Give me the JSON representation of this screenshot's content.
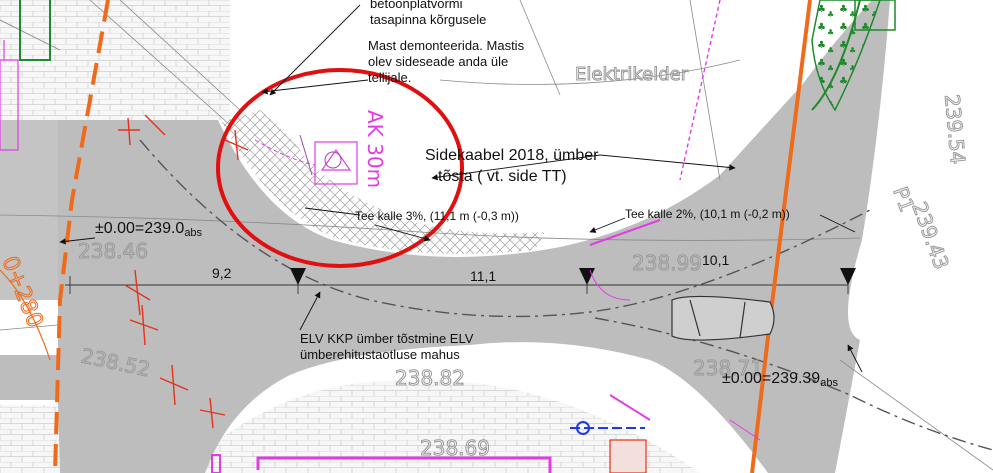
{
  "colors": {
    "road": "#bdbdbd",
    "paving_lines": "#d3d3d3",
    "redline": "#e8301c",
    "markup_circle": "#e01010",
    "magenta": "#e23be6",
    "orange": "#f06a1c",
    "green": "#1d8a2b",
    "blue": "#1f3ce0"
  },
  "annotations": {
    "top_note": "betoonplatvormi\ntasapinna kõrgusele",
    "mast_note": "Mast demonteerida. Mastis\nolev sideseade anda üle\ntellijale.",
    "cable_note": "Sidekaabel 2018,  ümber\ntõsta ( vt. side TT)",
    "slope_left": "Tee kalle 3%, (11,1 m (-0,3 m))",
    "slope_right": "Tee kalle 2%, (10,1 m (-0,2 m))",
    "elv_note": "ELV KKP ümber tõstmine ELV\nümberehitustaotluse mahus",
    "level_left": {
      "main": "±0.00=239.0",
      "sub": "abs"
    },
    "level_right": {
      "main": "±0.00=239.39",
      "sub": "abs"
    }
  },
  "dimensions": [
    "9,2",
    "11,1",
    "10,1"
  ],
  "labels": {
    "ak": "AK 30m",
    "elektrikelder": "Elektrikelder"
  },
  "ghost_elevations": [
    "239.54",
    "P1",
    "239.43",
    "238.46",
    "238.52",
    "238.82",
    "238.99",
    "238.71",
    "238.69"
  ],
  "station_label": "0+280"
}
